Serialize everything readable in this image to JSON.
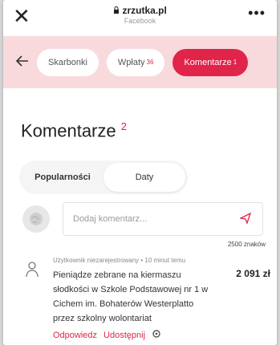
{
  "browser": {
    "host": "zrzutka.pl",
    "subtitle": "Facebook",
    "close_glyph": "✕",
    "more_glyph": "•••"
  },
  "nav": {
    "back_icon": "arrow-left-icon",
    "tabs": [
      {
        "label": "Skarbonki",
        "count": ""
      },
      {
        "label": "Wpłaty",
        "count": "36"
      },
      {
        "label": "Komentarze",
        "count": "1"
      }
    ]
  },
  "title": {
    "text": "Komentarze",
    "count": "2"
  },
  "sort": {
    "options": [
      "Popularności",
      "Daty"
    ]
  },
  "compose": {
    "placeholder": "Dodaj komentarz...",
    "counter": "2500 znaków",
    "send_icon": "send-icon"
  },
  "comment": {
    "meta": "Użytkownik niezarejestrowany • 10 minut temu",
    "text": "Pieniądze zebrane na kiermaszu słodkości w Szkole Podstawowej nr 1 w Cichem im. Bohaterów Westerplatto przez szkolny wolontariat",
    "amount": "2 091 zł",
    "reply": "Odpowiedz",
    "share": "Udostępnij"
  },
  "colors": {
    "accent": "#e0244a",
    "band": "#f8dadd"
  }
}
